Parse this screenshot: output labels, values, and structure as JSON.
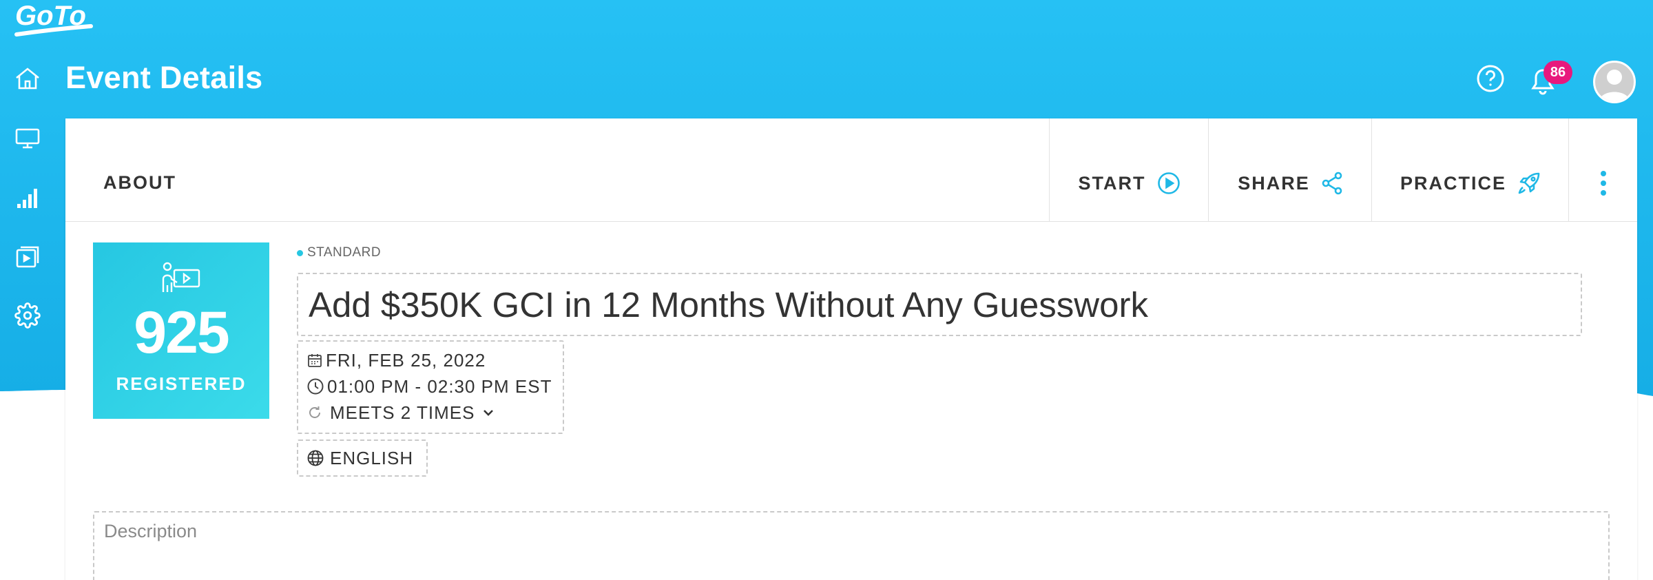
{
  "header": {
    "brand": "GoTo",
    "title": "Event Details",
    "notification_count": "86"
  },
  "tabs": {
    "about": "ABOUT"
  },
  "actions": {
    "start": "START",
    "share": "SHARE",
    "practice": "PRACTICE"
  },
  "registered": {
    "count": "925",
    "label": "REGISTERED"
  },
  "event": {
    "type": "STANDARD",
    "title": "Add $350K GCI in 12 Months Without Any Guesswork",
    "date": "FRI, FEB 25, 2022",
    "time": "01:00 PM - 02:30 PM EST",
    "recurrence": "MEETS 2 TIMES",
    "language": "ENGLISH"
  },
  "description": {
    "placeholder": "Description"
  },
  "colors": {
    "header_blue": "#1fb8f0",
    "accent_cyan": "#26c7e2",
    "badge_pink": "#e8197d"
  }
}
